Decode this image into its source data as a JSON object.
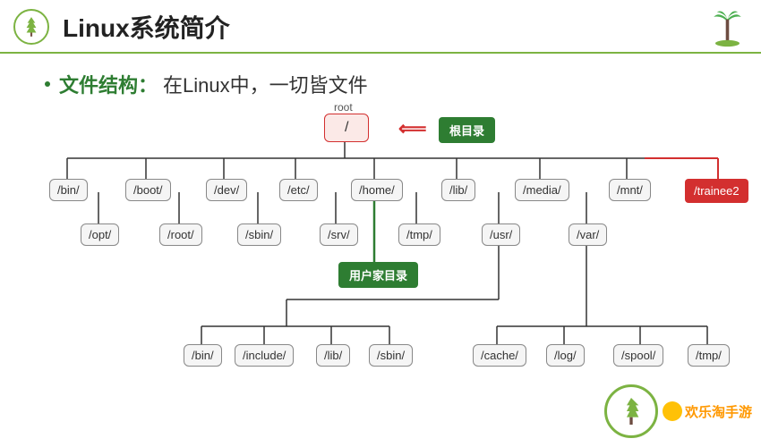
{
  "header": {
    "title": "Linux系统简介"
  },
  "subtitle": {
    "label": "文件结构：",
    "text": "在Linux中，一切皆文件"
  },
  "tree": {
    "root_label": "root",
    "root": "/",
    "root_badge": "根目录",
    "level1": [
      "/bin/",
      "/boot/",
      "/dev/",
      "/etc/",
      "/home/",
      "/lib/",
      "/media/",
      "/mnt/"
    ],
    "level1b": [
      "/opt/",
      "/root/",
      "/sbin/",
      "/srv/",
      "/tmp/",
      "/usr/",
      "/var/"
    ],
    "trainee": "/trainee2",
    "home_badge": "用户家目录",
    "usr_children": [
      "/bin/",
      "/include/",
      "/lib/",
      "/sbin/"
    ],
    "var_children": [
      "/cache/",
      "/log/",
      "/spool/",
      "/tmp/"
    ]
  },
  "watermark": {
    "text": "欢乐淘手游"
  }
}
